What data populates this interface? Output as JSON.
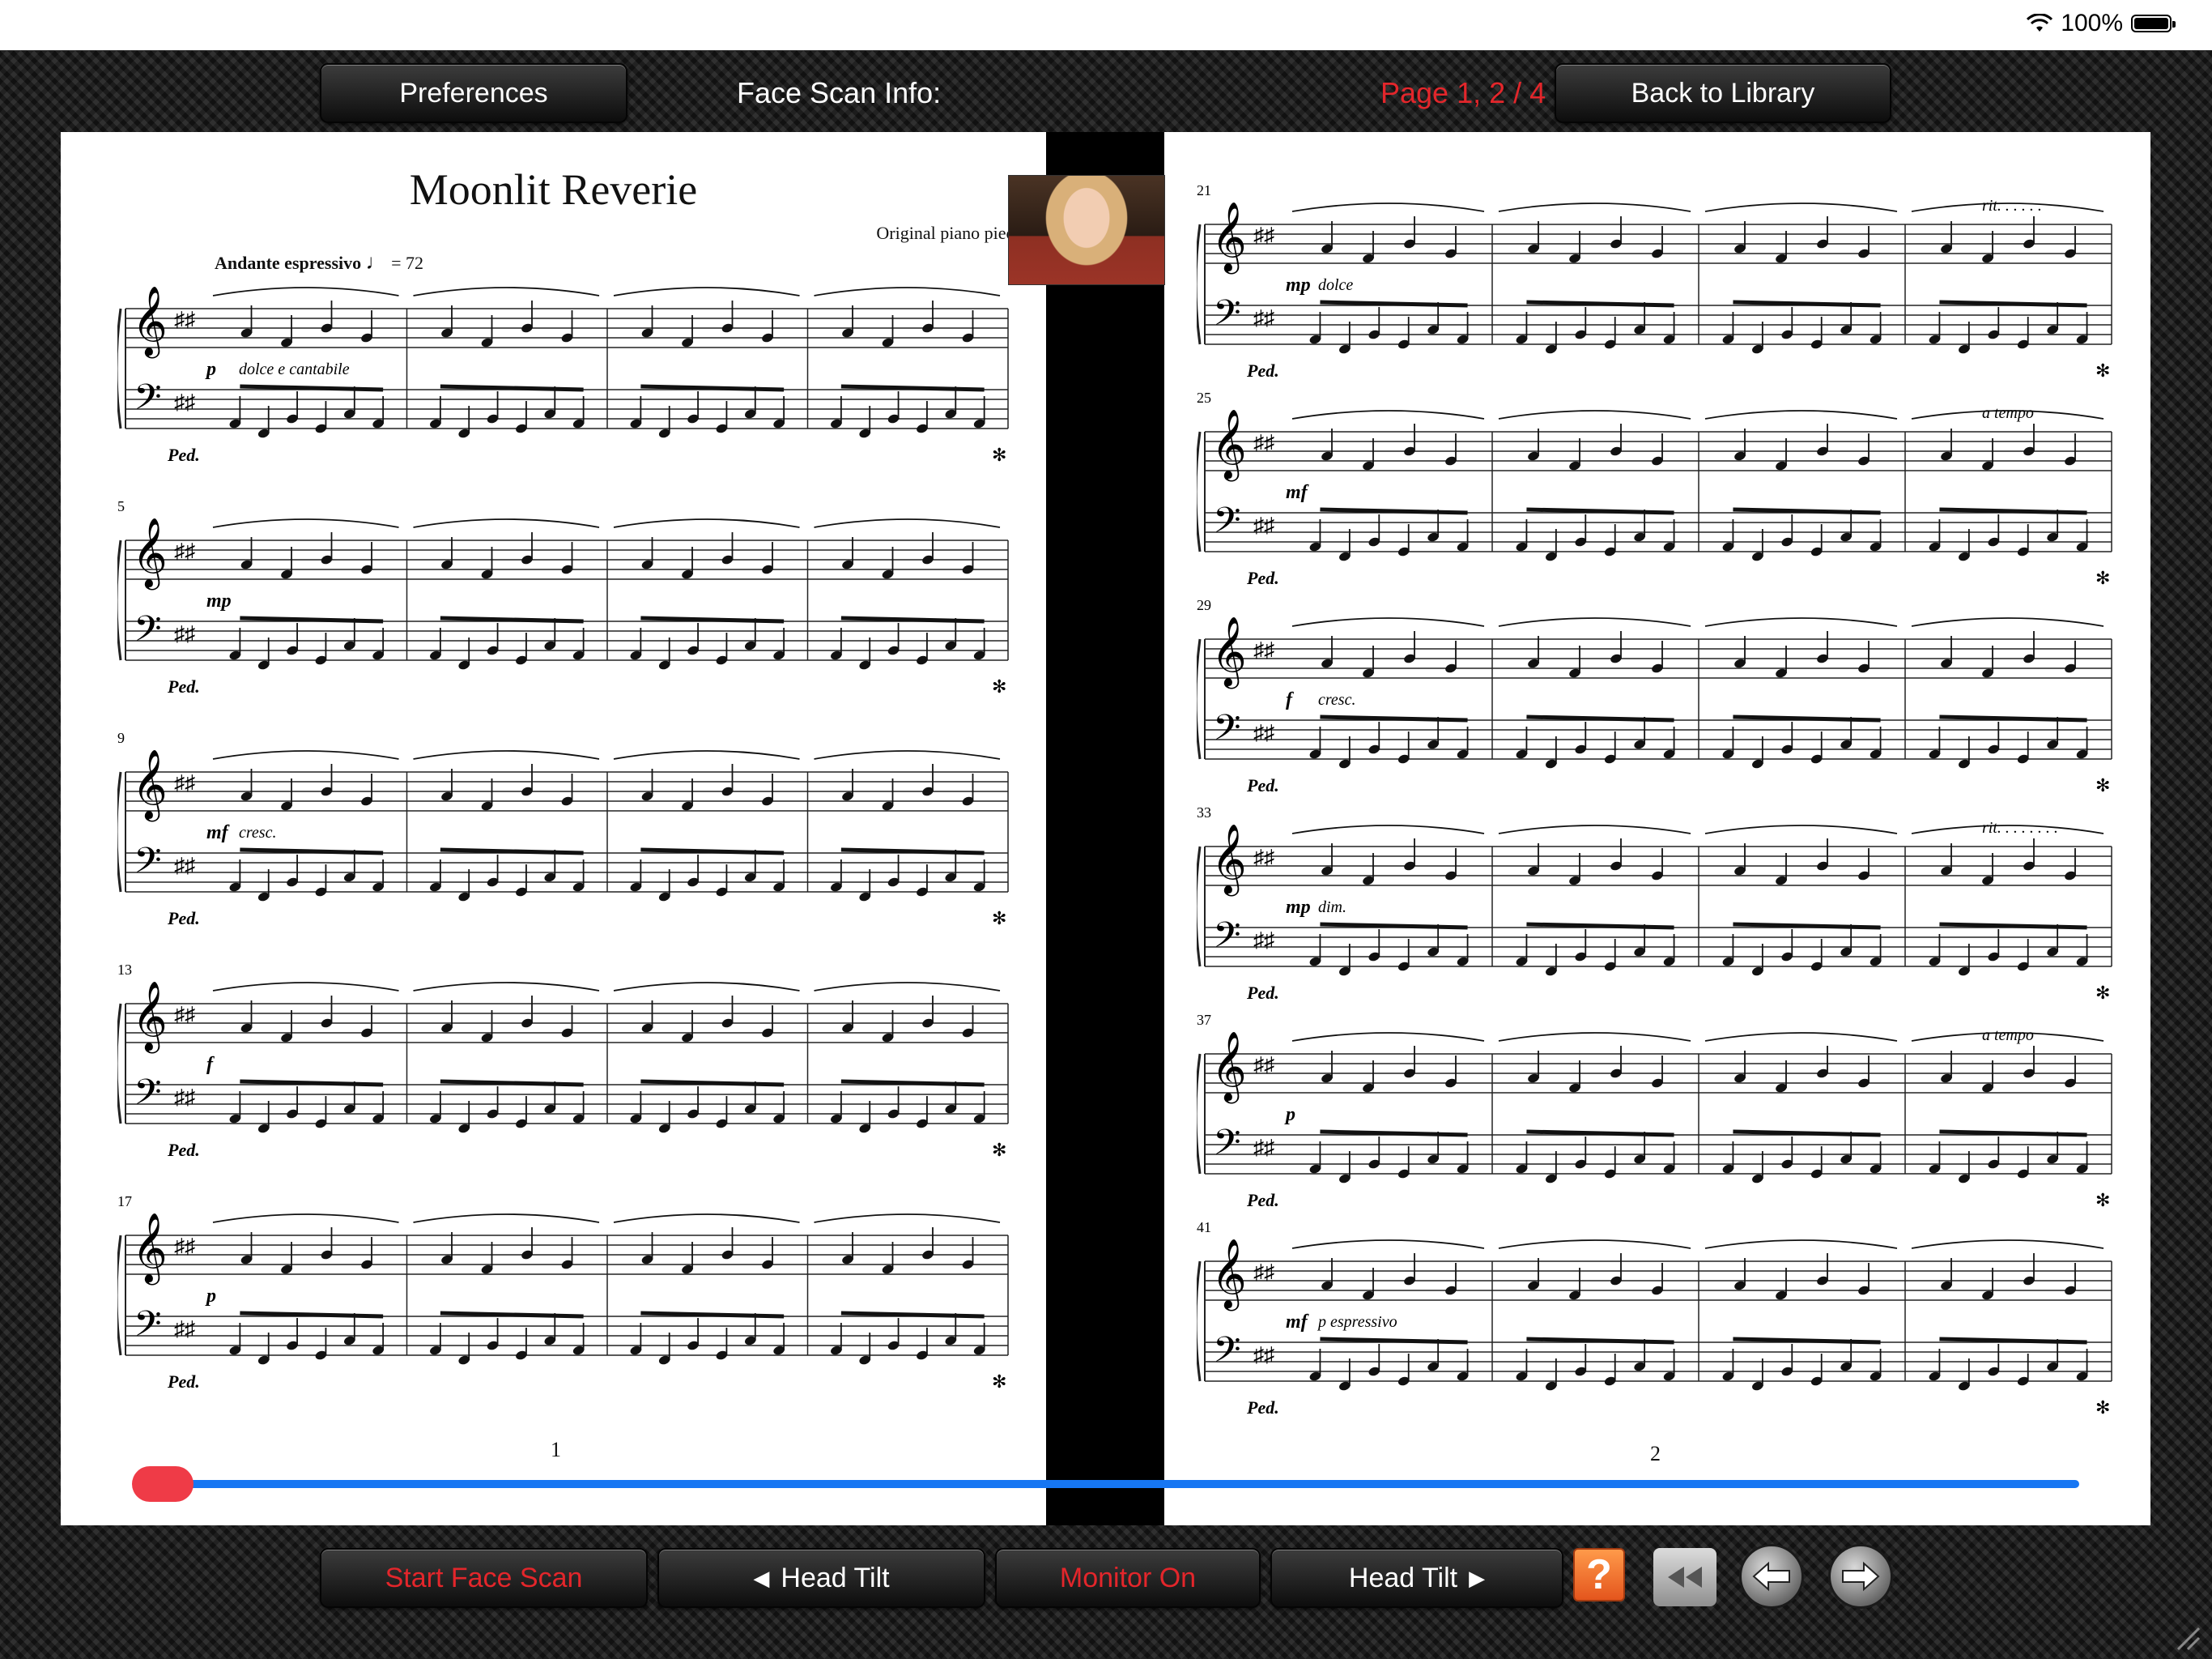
{
  "status_bar": {
    "battery_text": "100%",
    "wifi_icon": "wifi-icon",
    "battery_icon": "battery-icon"
  },
  "toolbar_top": {
    "preferences_label": "Preferences",
    "face_scan_info_label": "Face Scan Info:",
    "page_indicator": "Page 1, 2 / 4",
    "back_to_library_label": "Back to Library",
    "page_indicator_color": "#e3262b"
  },
  "score": {
    "title": "Moonlit Reverie",
    "subtitle": "Original piano piece",
    "tempo": "Andante espressivo",
    "metronome": "= 72",
    "page1": {
      "number": "1",
      "systems": [
        {
          "measure": "",
          "dynamic": "p",
          "expression": "dolce e cantabile",
          "pedal": "Ped."
        },
        {
          "measure": "5",
          "dynamic": "mp",
          "expression": "",
          "pedal": "Ped."
        },
        {
          "measure": "9",
          "dynamic": "mf",
          "expression": "cresc.",
          "pedal": "Ped."
        },
        {
          "measure": "13",
          "dynamic": "f",
          "expression": "",
          "pedal": "Ped."
        },
        {
          "measure": "17",
          "dynamic": "p",
          "expression": "",
          "pedal": "Ped."
        }
      ]
    },
    "page2": {
      "number": "2",
      "systems": [
        {
          "measure": "21",
          "dynamic": "mp",
          "expression": "dolce",
          "tempo_mark": "rit. . . . . .",
          "pedal": "Ped."
        },
        {
          "measure": "25",
          "dynamic": "mf",
          "expression": "",
          "tempo_mark": "a tempo",
          "pedal": "Ped."
        },
        {
          "measure": "29",
          "dynamic": "f",
          "expression": "cresc.",
          "tempo_mark": "",
          "pedal": "Ped."
        },
        {
          "measure": "33",
          "dynamic": "mp",
          "expression": "dim.",
          "tempo_mark": "rit. . . . . . . .",
          "pedal": "Ped."
        },
        {
          "measure": "37",
          "dynamic": "p",
          "expression": "",
          "tempo_mark": "a tempo",
          "pedal": "Ped."
        },
        {
          "measure": "41",
          "dynamic": "mf",
          "expression": "p espressivo",
          "tempo_mark": "",
          "pedal": "Ped."
        }
      ]
    }
  },
  "slider": {
    "progress": 0.0,
    "track_color": "#1676f3",
    "thumb_color": "#ef3b47"
  },
  "toolbar_bottom": {
    "start_face_scan_label": "Start Face Scan",
    "head_tilt_left_label": "Head Tilt",
    "monitor_on_label": "Monitor On",
    "head_tilt_right_label": "Head Tilt",
    "help_label": "?"
  }
}
